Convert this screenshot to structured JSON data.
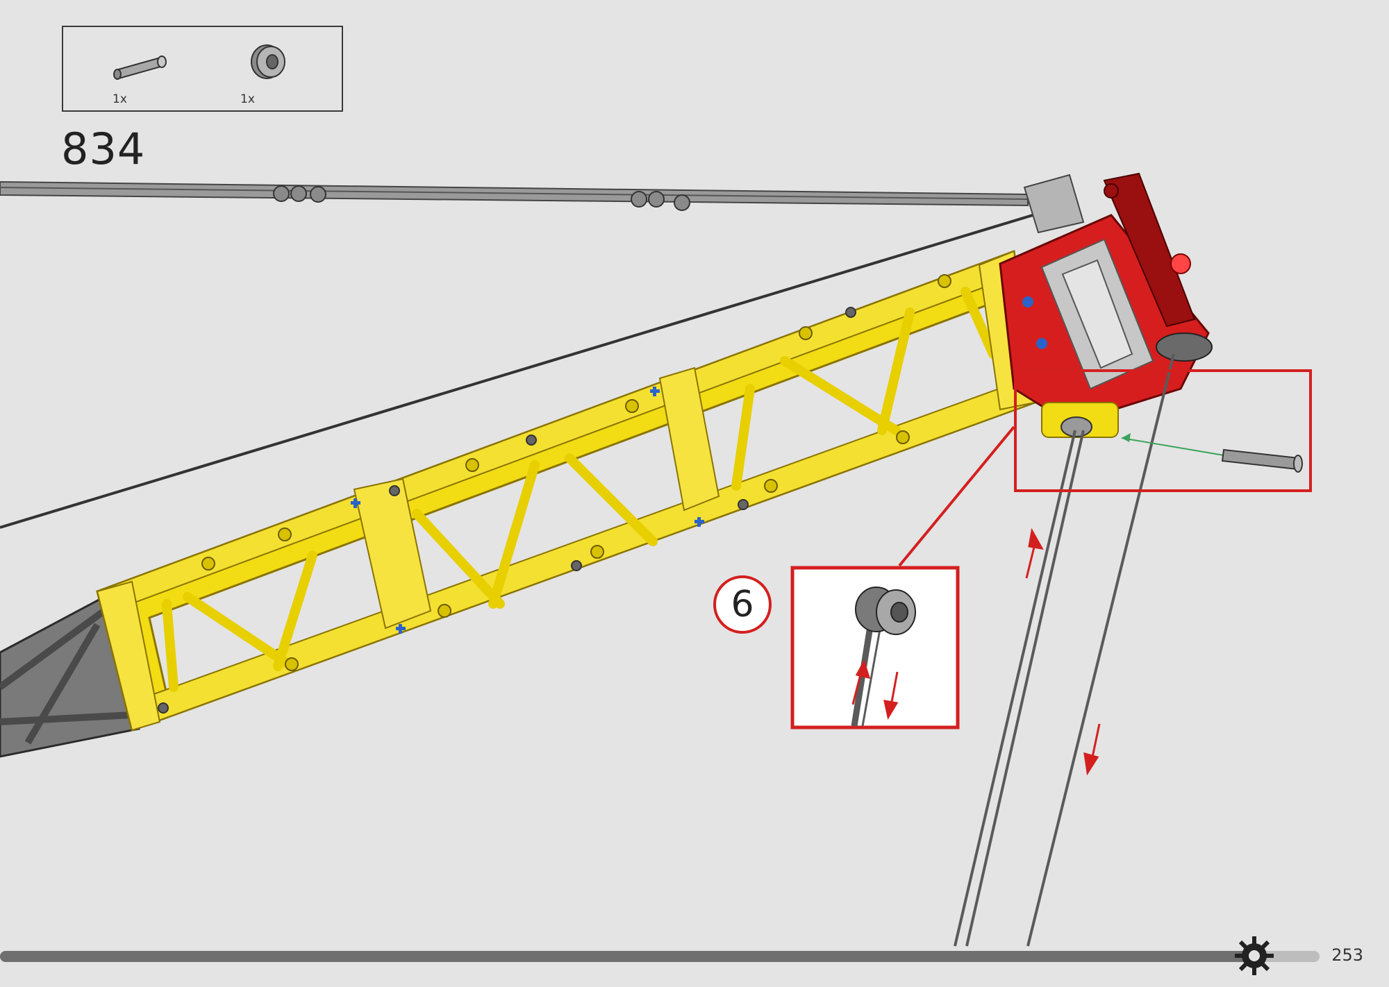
{
  "step": {
    "number": "834",
    "sub_step": "6"
  },
  "parts": [
    {
      "name": "axle-pin",
      "qty": "1x"
    },
    {
      "name": "bush-pulley",
      "qty": "1x"
    }
  ],
  "page": {
    "number": "253"
  },
  "colors": {
    "background": "#e4e4e4",
    "boom_yellow": "#f2dc14",
    "boom_yellow_edge": "#b39a00",
    "head_red": "#d71e1e",
    "callout_red": "#d41f1f",
    "dark_grey": "#5a5a5a",
    "insert_arrow_green": "#3aa35a"
  },
  "icons": [
    "gear-icon",
    "axle-pin-icon",
    "pulley-icon",
    "arrow-up-icon",
    "arrow-down-icon"
  ]
}
